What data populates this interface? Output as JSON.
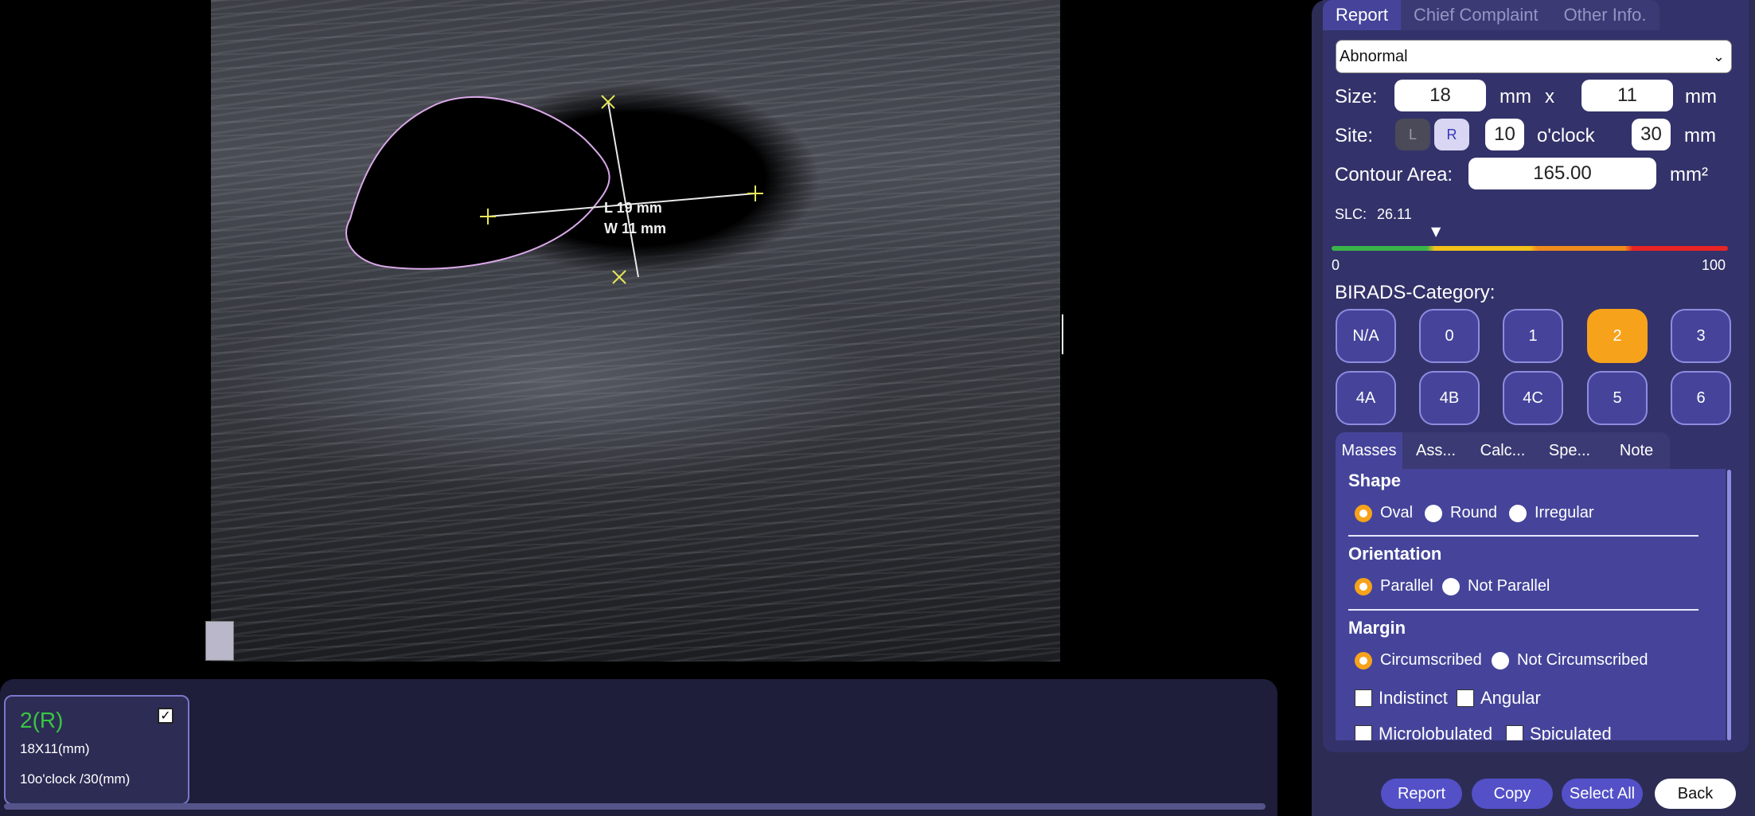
{
  "viewer": {
    "measure_line1": "L 19 mm",
    "measure_line2": "W 11 mm",
    "colors": {
      "contour": "#d9a8e8",
      "marker": "#e6e65a"
    }
  },
  "thumbnail": {
    "title": "2(R)",
    "size": "18X11(mm)",
    "site": "10o'clock /30(mm)",
    "checked": true
  },
  "panel": {
    "tabs": [
      "Report",
      "Chief Complaint",
      "Other Info."
    ],
    "finding_select": "Abnormal",
    "size_label": "Size:",
    "size_w": "18",
    "size_unit1": "mm",
    "size_x": "x",
    "size_h": "11",
    "size_unit2": "mm",
    "site_label": "Site:",
    "side_l": "L",
    "side_r": "R",
    "site_hour": "10",
    "oclock": "o'clock",
    "site_dist": "30",
    "site_unit": "mm",
    "contour_label": "Contour Area:",
    "contour_value": "165.00",
    "contour_unit": "mm²",
    "slc_label": "SLC:",
    "slc_value": "26.11",
    "slc_min": "0",
    "slc_max": "100",
    "birads_label": "BIRADS-Category:",
    "birads": [
      "N/A",
      "0",
      "1",
      "2",
      "3",
      "4A",
      "4B",
      "4C",
      "5",
      "6"
    ],
    "birads_selected": "2",
    "subtabs": [
      "Masses",
      "Ass...",
      "Calc...",
      "Spe...",
      "Note"
    ],
    "shape_title": "Shape",
    "shape_options": [
      "Oval",
      "Round",
      "Irregular"
    ],
    "shape_selected": "Oval",
    "orientation_title": "Orientation",
    "orientation_options": [
      "Parallel",
      "Not Parallel"
    ],
    "orientation_selected": "Parallel",
    "margin_title": "Margin",
    "margin_options": [
      "Circumscribed",
      "Not Circumscribed"
    ],
    "margin_selected": "Circumscribed",
    "margin_checks": [
      "Indistinct",
      "Angular",
      "Microlobulated",
      "Spiculated"
    ],
    "buttons": {
      "report": "Report",
      "copy": "Copy",
      "select_all": "Select All",
      "back": "Back"
    }
  }
}
